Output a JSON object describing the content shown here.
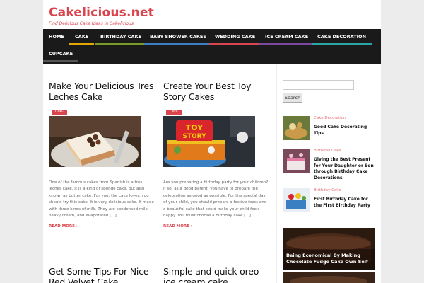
{
  "site": {
    "title": "Cakelicious.net",
    "tagline": "Find Delicious Cake Ideas in Cakelicious"
  },
  "nav": [
    {
      "label": "HOME",
      "color": "#1a1a1a"
    },
    {
      "label": "CAKE",
      "color": "#e0a800"
    },
    {
      "label": "BIRTHDAY CAKE",
      "color": "#7a9a2a"
    },
    {
      "label": "BABY SHOWER CAKES",
      "color": "#3a7fc1"
    },
    {
      "label": "WEDDING CAKE",
      "color": "#d9444d"
    },
    {
      "label": "ICE CREAM CAKE",
      "color": "#7b4aa0"
    },
    {
      "label": "CAKE DECORATION",
      "color": "#2aa6a6"
    },
    {
      "label": "CUPCAKE",
      "color": "#1a1a1a"
    }
  ],
  "posts": [
    {
      "title": "Make Your Delicious Tres Leches Cake",
      "category": "CAKE",
      "excerpt": "One of the famous cakes from Spanish is a tres leches cake. It is a kind of sponge cake, but also known as butter cake. For you, the cake lover, you should try this cake. It is very delicious cake. It made with three kinds of milk. They are condensed milk, heavy cream, and evaporated [...]",
      "read_more": "READ MORE"
    },
    {
      "title": "Create Your Best Toy Story Cakes",
      "category": "CAKE",
      "excerpt": "Are you preparing a birthday party for your children? If so, as a good parent, you have to prepare the celebration as good as possible. For the special day of your child, you should prepare a festive feast and a beautiful cake that could make your child feels happy. You must choose a birthday cake [...]",
      "read_more": "READ MORE"
    },
    {
      "title": "Get Some Tips For Nice Red Velvet Cake"
    },
    {
      "title": "Simple and quick oreo ice cream cake"
    }
  ],
  "sidebar": {
    "search_button": "Search",
    "search_placeholder": "",
    "items": [
      {
        "category": "Cake Decoration",
        "title": "Good Cake Decorating Tips"
      },
      {
        "category": "Birthday Cake",
        "title": "Giving the Best Present for Your Daughter or Son through Birthday Cake Decorations"
      },
      {
        "category": "Birthday Cake",
        "title": "First Birthday Cake for the First Birthday Party"
      }
    ],
    "feature_title": "Being Economical By Making Chocolate Fudge Cake Own Self"
  },
  "colors": {
    "accent": "#d9444d",
    "nav_bg": "#1a1a1a"
  }
}
